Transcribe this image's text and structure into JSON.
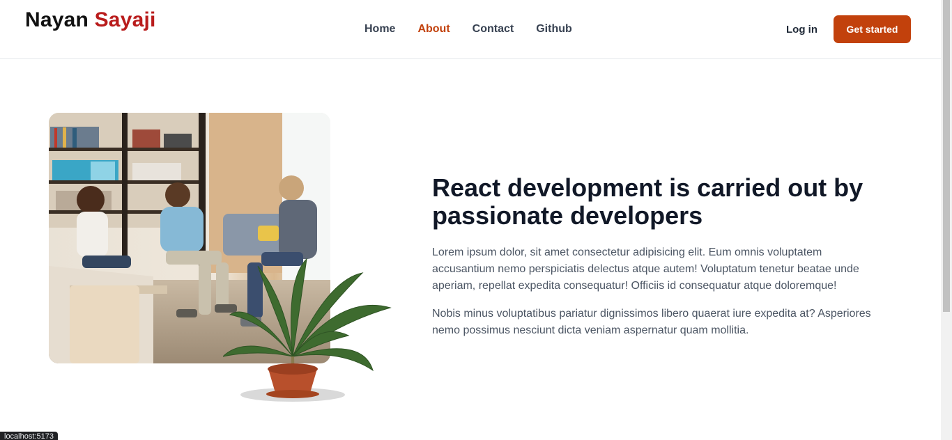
{
  "header": {
    "brand_first": "Nayan",
    "brand_last": "Sayaji",
    "nav": [
      "Home",
      "About",
      "Contact",
      "Github"
    ],
    "active_nav": "About",
    "login": "Log in",
    "cta": "Get started"
  },
  "colors": {
    "accent": "#c2410c",
    "brand_red": "#b91c1c",
    "heading": "#111827",
    "body_text": "#4b5563"
  },
  "hero": {
    "heading": "React development is carried out by passionate developers",
    "paragraph1": "Lorem ipsum dolor, sit amet consectetur adipisicing elit. Eum omnis voluptatem accusantium nemo perspiciatis delectus atque autem! Voluptatum tenetur beatae unde aperiam, repellat expedita consequatur! Officiis id consequatur atque doloremque!",
    "paragraph2": "Nobis minus voluptatibus pariatur dignissimos libero quaerat iure expedita at? Asperiores nemo possimus nesciunt dicta veniam aspernatur quam mollitia."
  },
  "status_bar": "localhost:5173"
}
